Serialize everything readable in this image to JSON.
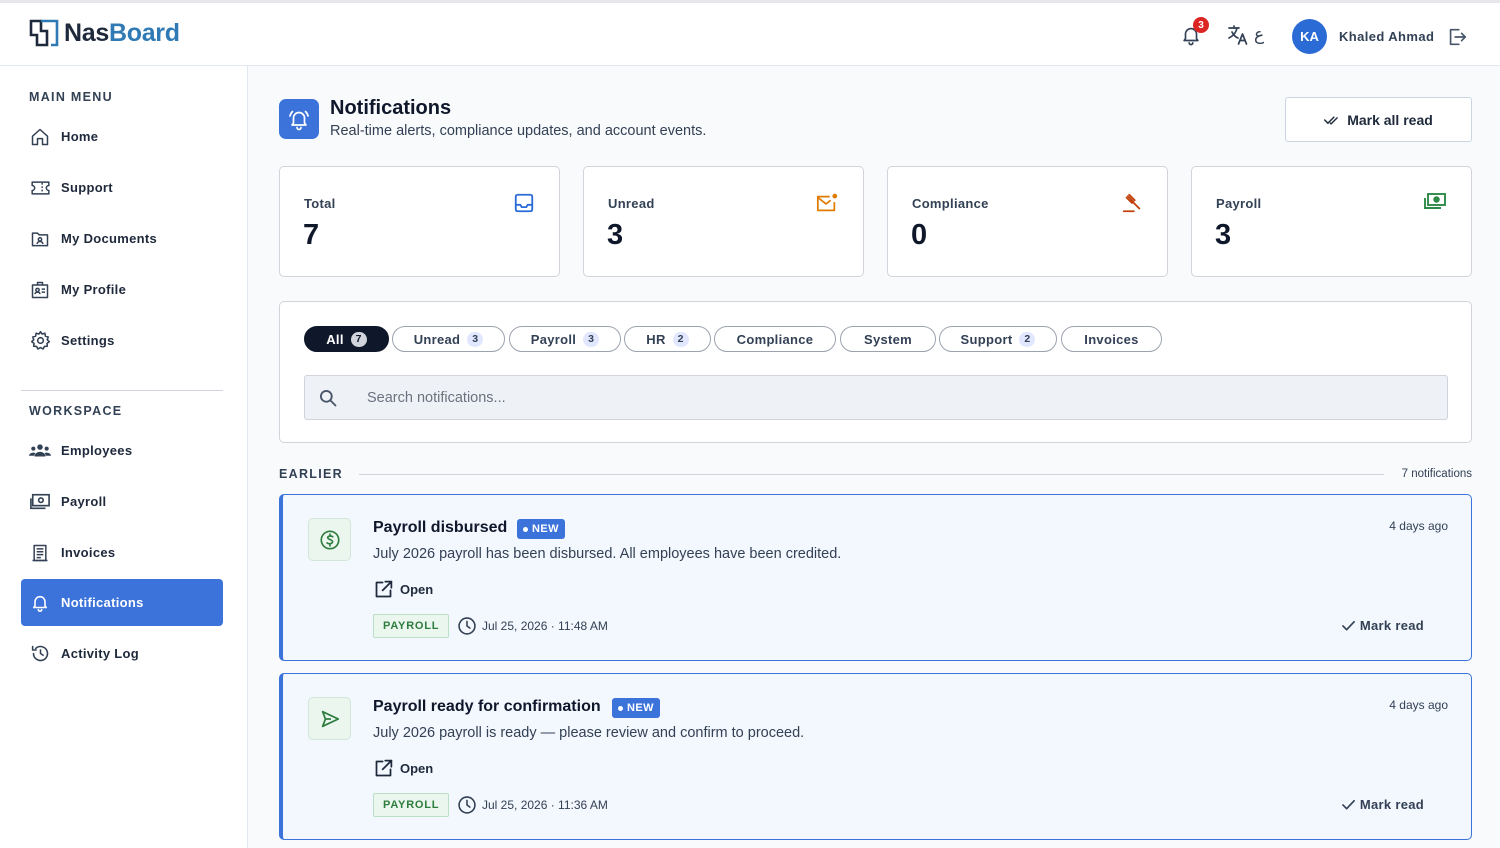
{
  "app": {
    "brand_prefix": "Nas",
    "brand_suffix": "Board"
  },
  "header": {
    "notification_count": "3",
    "language_label": "ع",
    "user_initials": "KA",
    "user_name": "Khaled Ahmad"
  },
  "sidebar": {
    "main_menu_label": "MAIN MENU",
    "workspace_label": "WORKSPACE",
    "main_items": [
      {
        "label": "Home",
        "icon": "home-icon"
      },
      {
        "label": "Support",
        "icon": "ticket-icon"
      },
      {
        "label": "My Documents",
        "icon": "folder-icon"
      },
      {
        "label": "My Profile",
        "icon": "id-badge-icon"
      },
      {
        "label": "Settings",
        "icon": "gear-icon"
      }
    ],
    "workspace_items": [
      {
        "label": "Employees",
        "icon": "users-icon"
      },
      {
        "label": "Payroll",
        "icon": "cash-icon"
      },
      {
        "label": "Invoices",
        "icon": "receipt-icon"
      },
      {
        "label": "Notifications",
        "icon": "bell-icon",
        "active": true
      },
      {
        "label": "Activity Log",
        "icon": "history-icon"
      }
    ]
  },
  "page": {
    "title": "Notifications",
    "subtitle": "Real-time alerts, compliance updates, and account events.",
    "mark_all_label": "Mark all read"
  },
  "stats": [
    {
      "label": "Total",
      "value": "7",
      "icon": "inbox-icon",
      "color": "#2b6bd6"
    },
    {
      "label": "Unread",
      "value": "3",
      "icon": "mail-dot-icon",
      "color": "#e07b00"
    },
    {
      "label": "Compliance",
      "value": "0",
      "icon": "gavel-icon",
      "color": "#c2410c"
    },
    {
      "label": "Payroll",
      "value": "3",
      "icon": "cash-icon",
      "color": "#2e8b47"
    }
  ],
  "filters": [
    {
      "label": "All",
      "count": "7",
      "active": true
    },
    {
      "label": "Unread",
      "count": "3"
    },
    {
      "label": "Payroll",
      "count": "3"
    },
    {
      "label": "HR",
      "count": "2"
    },
    {
      "label": "Compliance",
      "count": ""
    },
    {
      "label": "System",
      "count": ""
    },
    {
      "label": "Support",
      "count": "2"
    },
    {
      "label": "Invoices",
      "count": ""
    }
  ],
  "search": {
    "placeholder": "Search notifications..."
  },
  "group": {
    "label": "EARLIER",
    "count_text": "7 notifications"
  },
  "notifications": [
    {
      "title": "Payroll disbursed",
      "badge": "NEW",
      "body": "July 2026 payroll has been disbursed. All employees have been credited.",
      "open_label": "Open",
      "tag": "PAYROLL",
      "timestamp": "Jul 25, 2026 · 11:48 AM",
      "ago": "4 days ago",
      "mark_read_label": "Mark read",
      "icon": "dollar-circle-icon"
    },
    {
      "title": "Payroll ready for confirmation",
      "badge": "NEW",
      "body": "July 2026 payroll is ready — please review and confirm to proceed.",
      "open_label": "Open",
      "tag": "PAYROLL",
      "timestamp": "Jul 25, 2026 · 11:36 AM",
      "ago": "4 days ago",
      "mark_read_label": "Mark read",
      "icon": "send-icon"
    }
  ],
  "colors": {
    "accent": "#3b73db",
    "success": "#2e8b47",
    "danger": "#dc2626"
  }
}
